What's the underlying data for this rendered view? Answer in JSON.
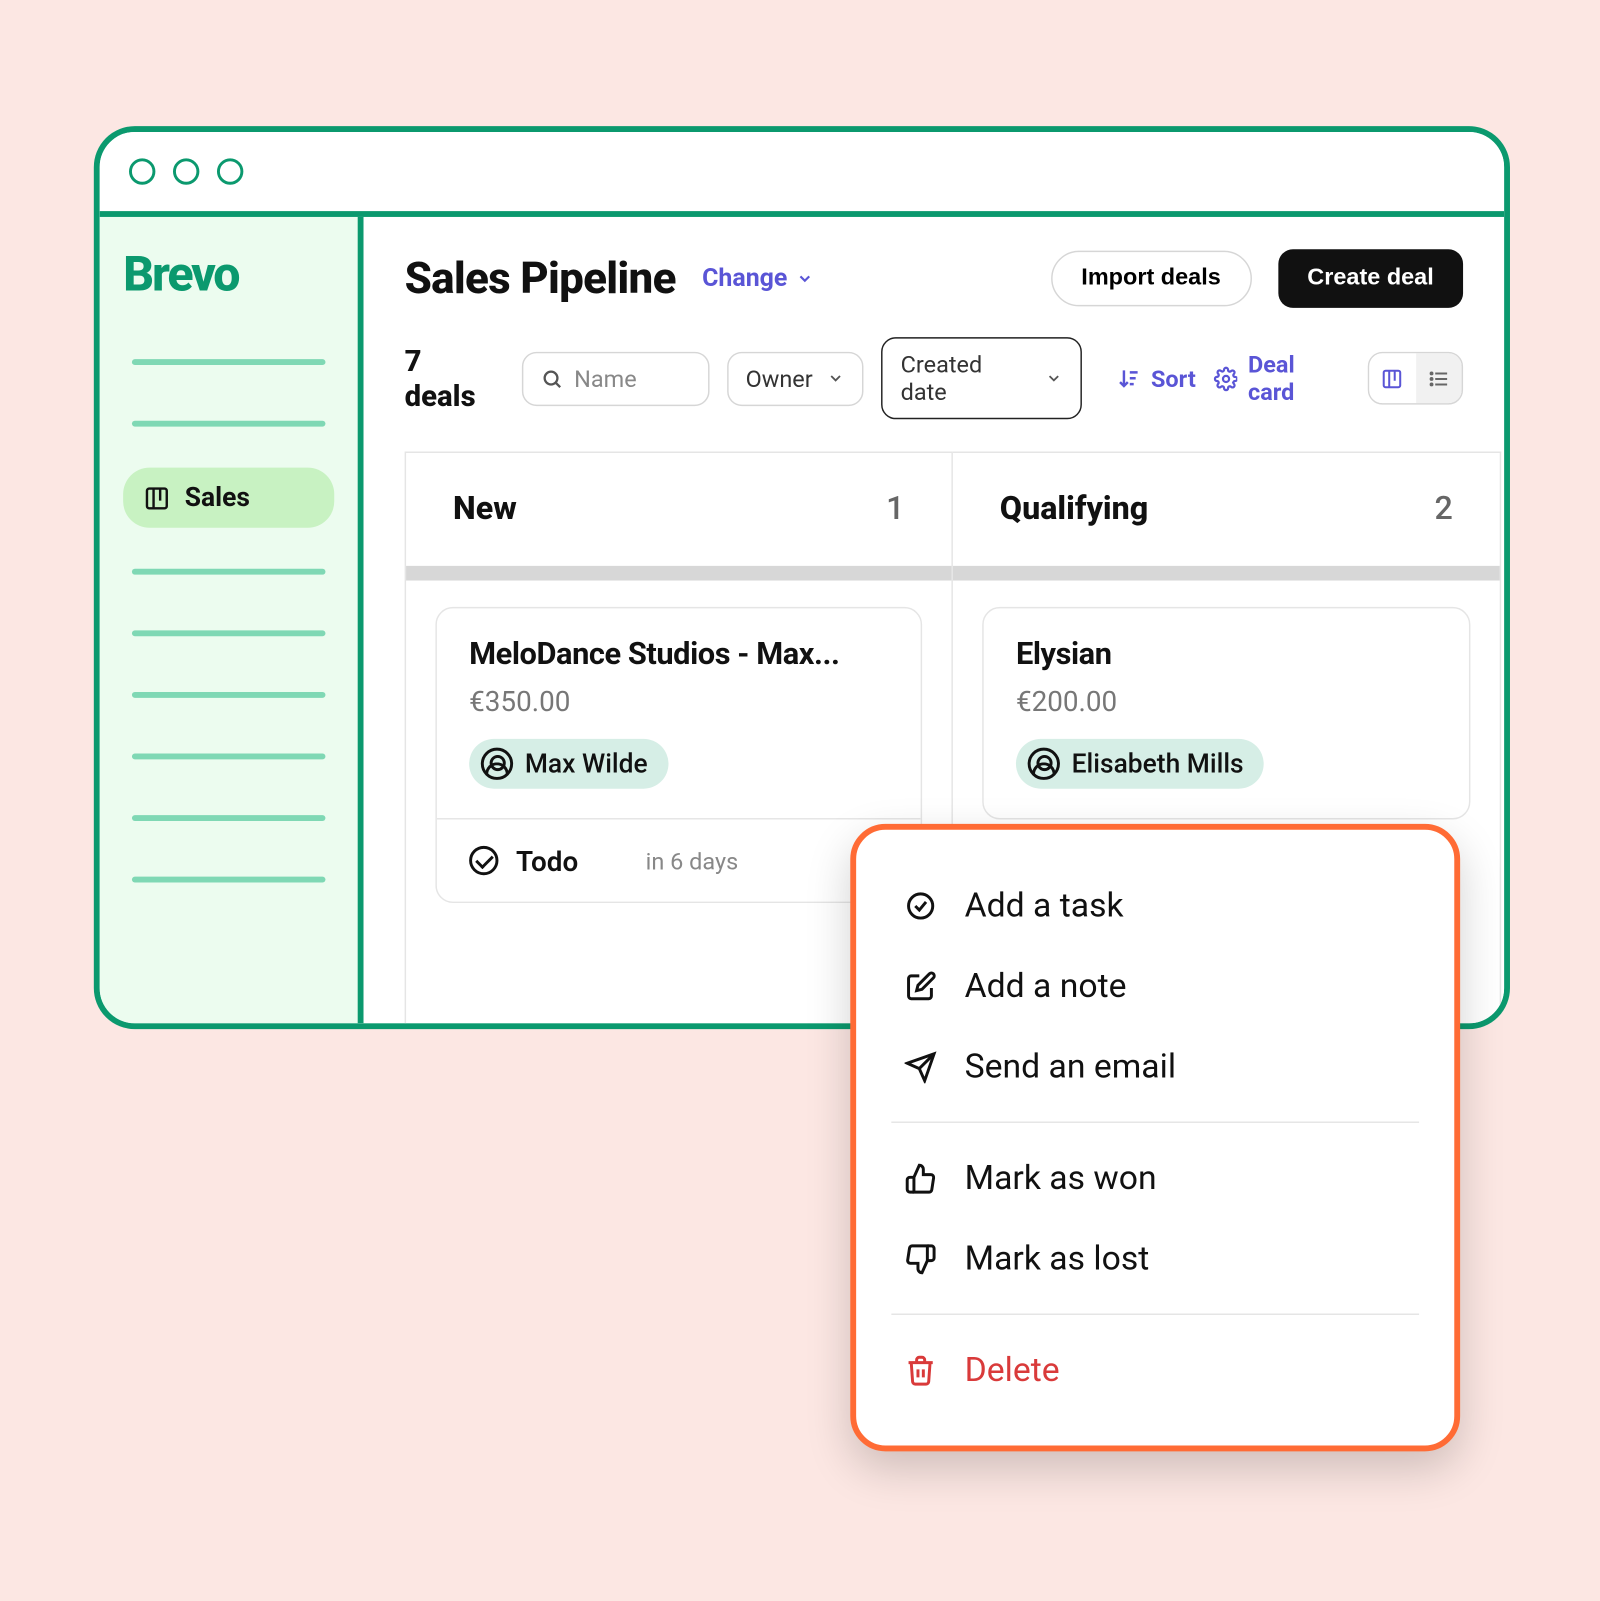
{
  "brand": "Brevo",
  "sidebar": {
    "active_item": "Sales"
  },
  "header": {
    "title": "Sales Pipeline",
    "change_label": "Change",
    "import_label": "Import deals",
    "create_label": "Create deal"
  },
  "filters": {
    "deal_count": "7 deals",
    "search_placeholder": "Name",
    "owner_label": "Owner",
    "created_label": "Created date",
    "sort_label": "Sort",
    "deal_card_label": "Deal card"
  },
  "columns": [
    {
      "title": "New",
      "count": "1",
      "cards": [
        {
          "title": "MeloDance Studios - Max...",
          "amount": "€350.00",
          "owner": "Max Wilde",
          "task_label": "Todo",
          "task_due": "in 6 days"
        }
      ]
    },
    {
      "title": "Qualifying",
      "count": "2",
      "cards": [
        {
          "title": "Elysian",
          "amount": "€200.00",
          "owner": "Elisabeth Mills"
        }
      ]
    }
  ],
  "context_menu": {
    "add_task": "Add a task",
    "add_note": "Add a note",
    "send_email": "Send an email",
    "mark_won": "Mark as won",
    "mark_lost": "Mark as lost",
    "delete": "Delete"
  }
}
